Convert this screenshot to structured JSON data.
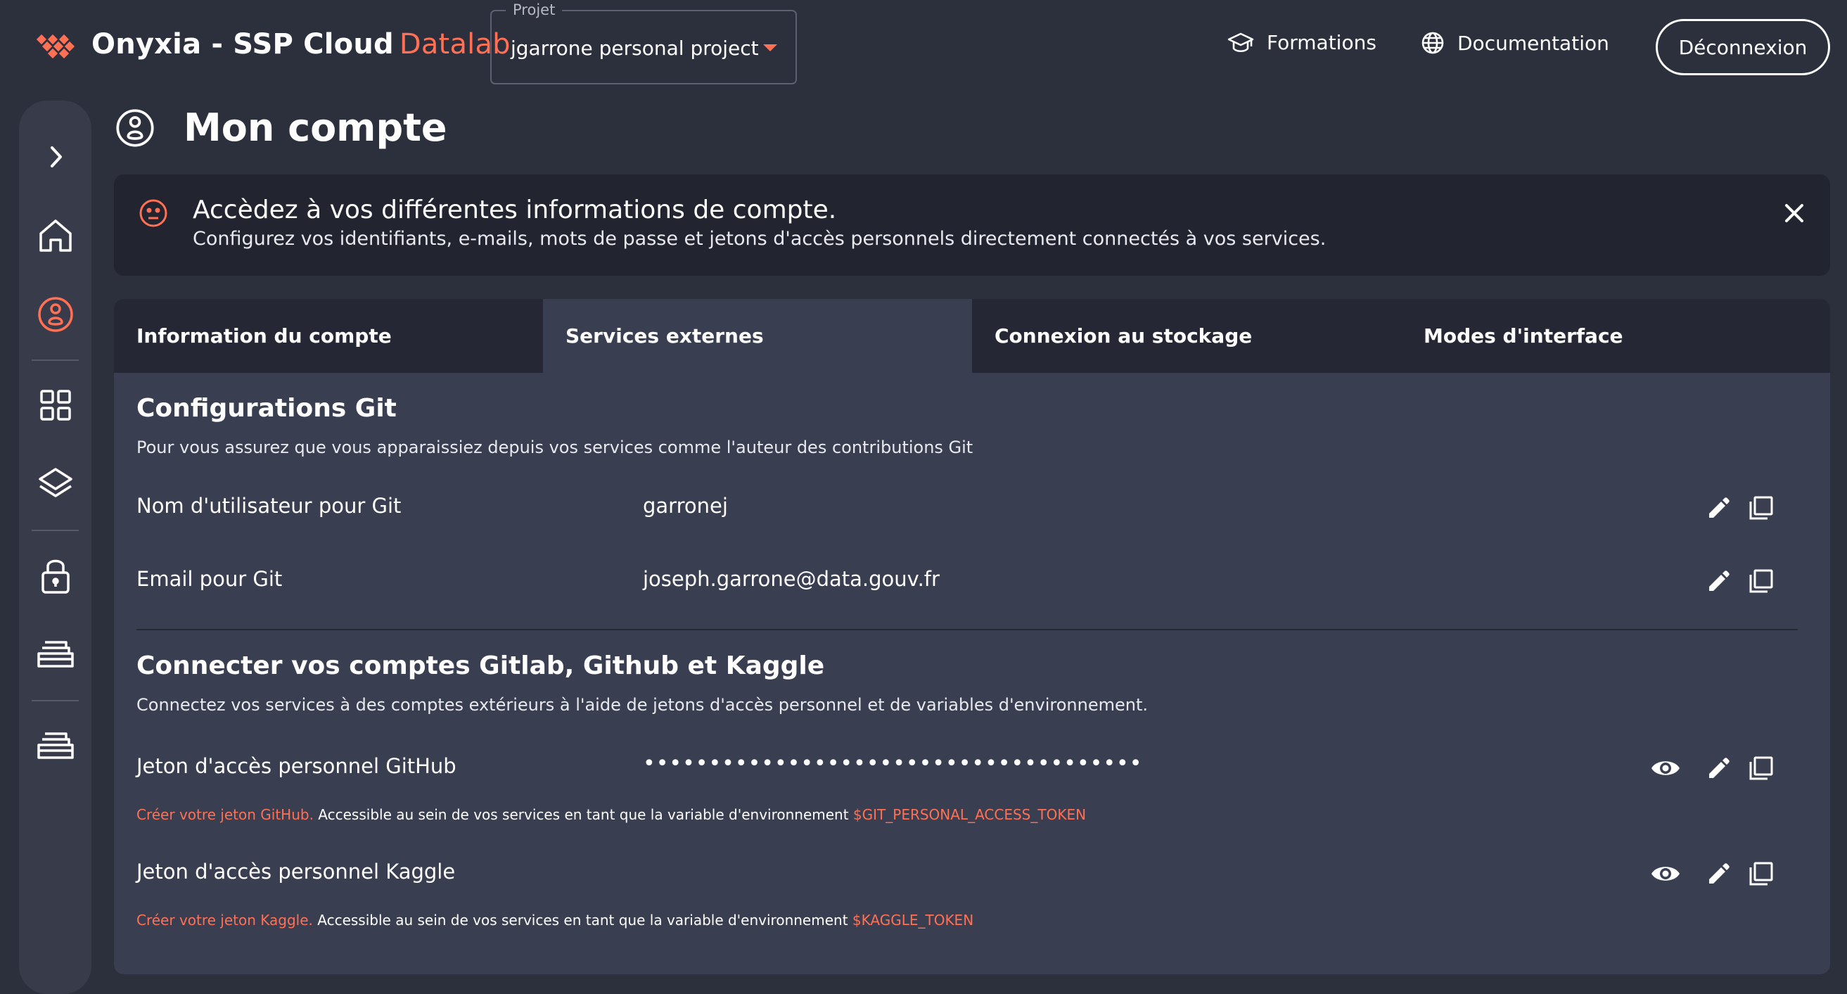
{
  "header": {
    "brand_name": "Onyxia - SSP Cloud",
    "brand_highlight": "Datalab",
    "project_label": "Projet",
    "project_value": "jgarrone personal project",
    "nav": [
      {
        "label": "Formations",
        "icon": "graduation-cap-icon"
      },
      {
        "label": "Documentation",
        "icon": "globe-icon"
      }
    ],
    "logout_label": "Déconnexion"
  },
  "sidebar": {
    "items": [
      {
        "icon": "chevron-right-icon",
        "active": false
      },
      {
        "icon": "home-icon",
        "active": false
      },
      {
        "icon": "account-icon",
        "active": true
      },
      {
        "icon": "catalog-grid-icon",
        "active": false
      },
      {
        "icon": "layers-icon",
        "active": false
      },
      {
        "icon": "lock-icon",
        "active": false
      },
      {
        "icon": "data-tray-icon",
        "active": false
      },
      {
        "icon": "storage-tray-icon",
        "active": false
      }
    ]
  },
  "page": {
    "title": "Mon compte",
    "banner": {
      "title": "Accèdez à vos différentes informations de compte.",
      "subtitle": "Configurez vos identifiants, e-mails, mots de passe et jetons d'accès personnels directement connectés à vos services."
    },
    "tabs": [
      {
        "label": "Information du compte",
        "active": false
      },
      {
        "label": "Services externes",
        "active": true
      },
      {
        "label": "Connexion au stockage",
        "active": false
      },
      {
        "label": "Modes d'interface",
        "active": false
      }
    ],
    "git": {
      "title": "Configurations Git",
      "description": "Pour vous assurez que vous apparaissiez depuis vos services comme l'auteur des contributions Git",
      "rows": [
        {
          "label": "Nom d'utilisateur pour Git",
          "value": "garronej"
        },
        {
          "label": "Email pour Git",
          "value": "joseph.garrone@data.gouv.fr"
        }
      ]
    },
    "tokens": {
      "title": "Connecter vos comptes Gitlab, Github et Kaggle",
      "description": "Connectez vos services à des comptes extérieurs à l'aide de jetons d'accès personnel et de variables d'environnement.",
      "github": {
        "label": "Jeton d'accès personnel GitHub",
        "masked_value": "••••••••••••••••••••••••••••••••••••••",
        "help_link": "Créer votre jeton GitHub.",
        "help_text": " Accessible au sein de vos services en tant que la variable d'environnement ",
        "help_var": "$GIT_PERSONAL_ACCESS_TOKEN"
      },
      "kaggle": {
        "label": "Jeton d'accès personnel Kaggle",
        "masked_value": "",
        "help_link": "Créer votre jeton Kaggle.",
        "help_text": " Accessible au sein de vos services en tant que la variable d'environnement ",
        "help_var": "$KAGGLE_TOKEN"
      }
    }
  },
  "colors": {
    "accent": "#ff7054",
    "background": "#2c2f3c",
    "panel": "#3a3e51",
    "banner": "#22242f"
  }
}
